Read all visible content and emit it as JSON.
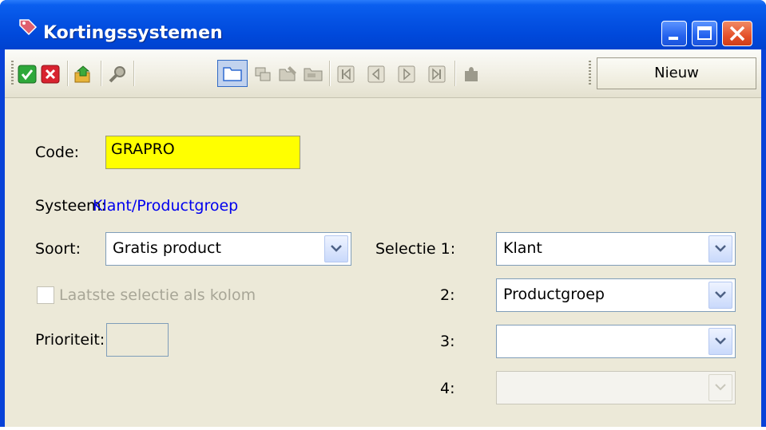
{
  "window": {
    "title": "Kortingssystemen"
  },
  "toolbar": {
    "buttons": [
      "ok-icon",
      "cancel-icon",
      "export-icon",
      "search-icon",
      "folder-icon",
      "copy-icon",
      "folder-edit-icon",
      "folder-closed-icon",
      "first-record-icon",
      "prev-record-icon",
      "next-record-icon",
      "last-record-icon",
      "puzzle-icon"
    ],
    "nieuw_label": "Nieuw"
  },
  "form": {
    "code_label": "Code:",
    "code_value": "GRAPRO",
    "systeem_label": "Systeem:",
    "systeem_value": "Klant/Productgroep",
    "soort_label": "Soort:",
    "soort_value": "Gratis product",
    "laatste_label": "Laatste selectie als kolom",
    "prioriteit_label": "Prioriteit:",
    "selectie1_label": "Selectie 1:",
    "selectie1_value": "Klant",
    "selectie2_label": "2:",
    "selectie2_value": "Productgroep",
    "selectie3_label": "3:",
    "selectie3_value": "",
    "selectie4_label": "4:",
    "selectie4_value": ""
  },
  "colors": {
    "titlebar": "#0054e3",
    "client": "#ece9d8",
    "code_bg": "#ffff00",
    "systeem_text": "#0000ee"
  }
}
